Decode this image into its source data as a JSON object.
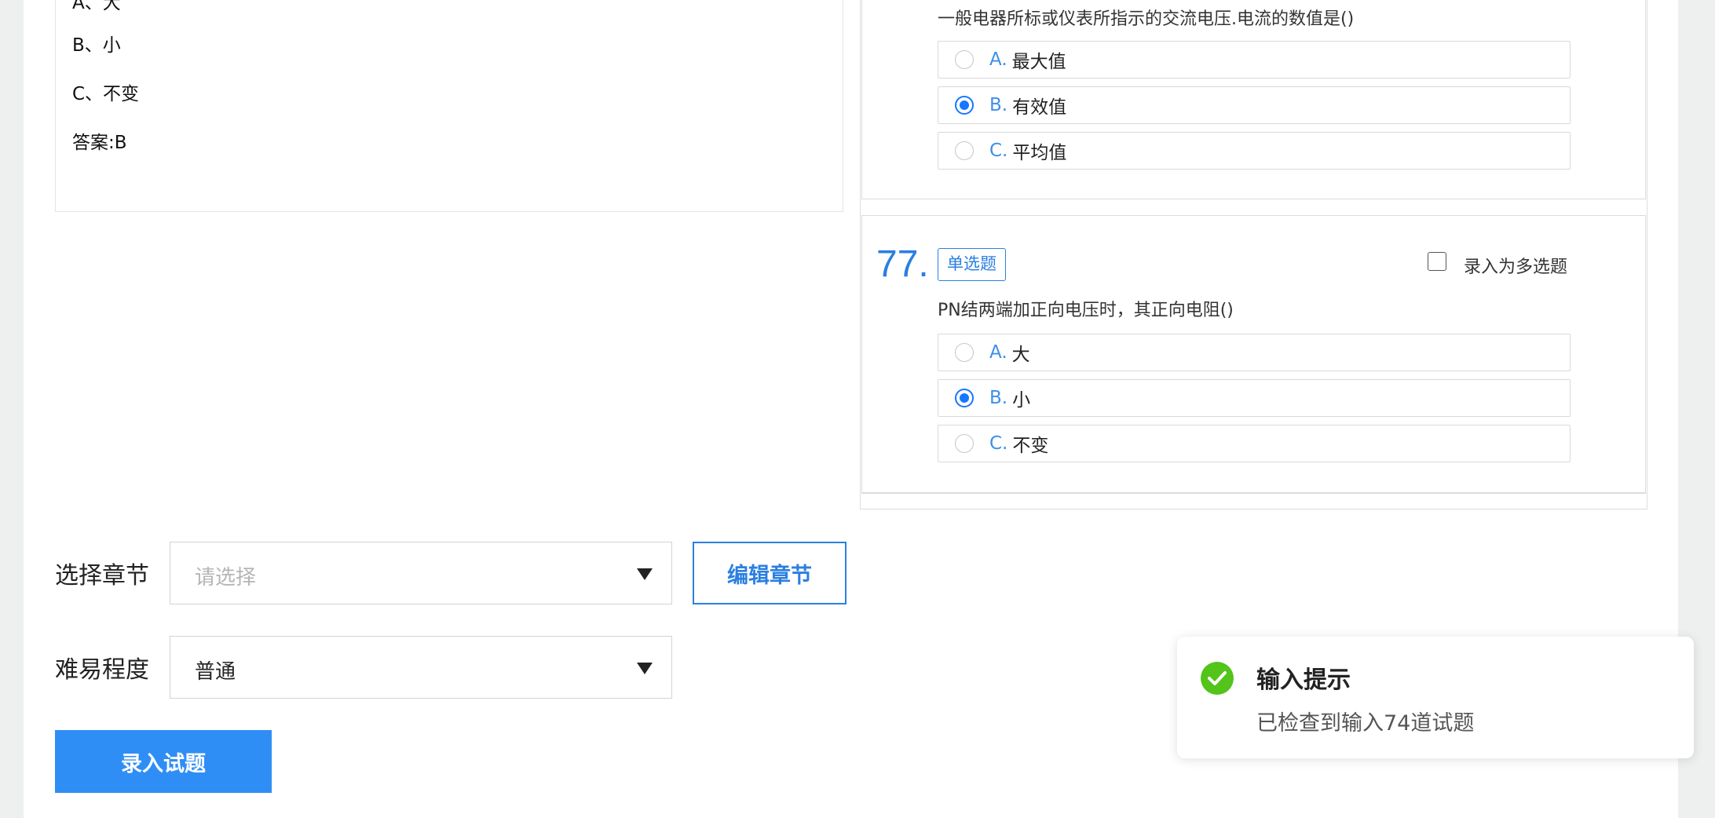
{
  "preview": {
    "partial_line": "A、大",
    "lines": [
      "B、小",
      "C、不变",
      "答案:B"
    ]
  },
  "questions": [
    {
      "text": "一般电器所标或仪表所指示的交流电压.电流的数值是()",
      "options": [
        {
          "letter": "A.",
          "text": "最大值",
          "checked": false
        },
        {
          "letter": "B.",
          "text": "有效值",
          "checked": true
        },
        {
          "letter": "C.",
          "text": "平均值",
          "checked": false
        }
      ]
    },
    {
      "number": "77.",
      "type": "单选题",
      "multi_label": "录入为多选题",
      "multi_checked": false,
      "text": "PN结两端加正向电压时，其正向电阻()",
      "options": [
        {
          "letter": "A.",
          "text": "大",
          "checked": false
        },
        {
          "letter": "B.",
          "text": "小",
          "checked": true
        },
        {
          "letter": "C.",
          "text": "不变",
          "checked": false
        }
      ]
    }
  ],
  "form": {
    "chapter_label": "选择章节",
    "chapter_placeholder": "请选择",
    "edit_chapter_button": "编辑章节",
    "difficulty_label": "难易程度",
    "difficulty_value": "普通",
    "submit_button": "录入试题"
  },
  "toast": {
    "title": "输入提示",
    "message": "已检查到输入74道试题",
    "icon": "check-circle-icon"
  },
  "colors": {
    "accent": "#2b7fe0",
    "radio_checked": "#1677ff",
    "success": "#52c41a",
    "submit_bg": "#2f8ef5"
  }
}
